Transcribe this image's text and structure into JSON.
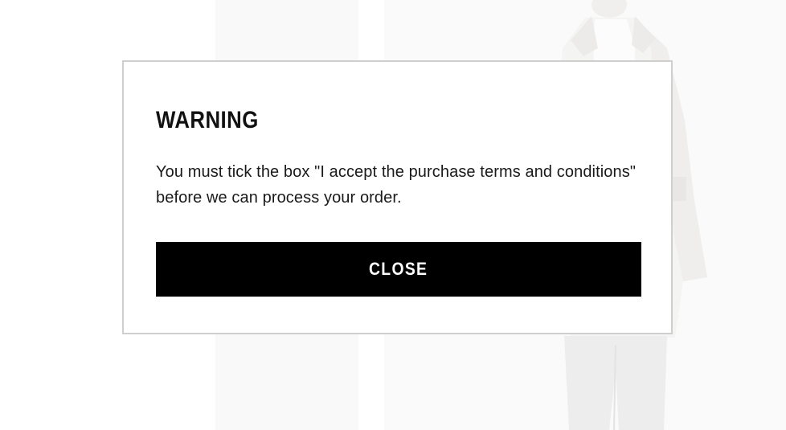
{
  "background": {
    "image_icon": "person-in-coat-image"
  },
  "dialog": {
    "title": "WARNING",
    "message": "You must tick the box \"I accept the purchase terms and conditions\" before we can process your order.",
    "close_label": "CLOSE"
  },
  "colors": {
    "button_background": "#000000",
    "button_text": "#ffffff",
    "dialog_border": "#cfcfcf",
    "text": "#111111"
  }
}
